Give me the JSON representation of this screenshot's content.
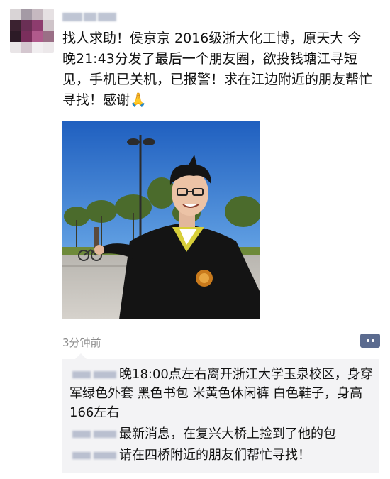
{
  "post": {
    "text": "找人求助！侯京京 2016级浙大化工博，原天大 今晚21:43分发了最后一个朋友圈，欲投钱塘江寻短见，手机已关机，已报警！求在江边附近的朋友帮忙寻找！感谢🙏",
    "timestamp": "3分钟前"
  },
  "colors": {
    "link_name": "#576b95",
    "timestamp": "#8a8a8a",
    "comment_bg": "#f3f3f5",
    "more_button": "#5b6b8f"
  },
  "icons": {
    "avatar": "avatar-pixelated",
    "more": "more-dots-icon"
  },
  "comments": [
    {
      "text": "晚18:00点左右离开浙江大学玉泉校区，身穿军绿色外套 黑色书包 米黄色休闲裤 白色鞋子，身高166左右"
    },
    {
      "text": "最新消息，在复兴大桥上捡到了他的包"
    },
    {
      "text": "请在四桥附近的朋友们帮忙寻找！"
    }
  ]
}
